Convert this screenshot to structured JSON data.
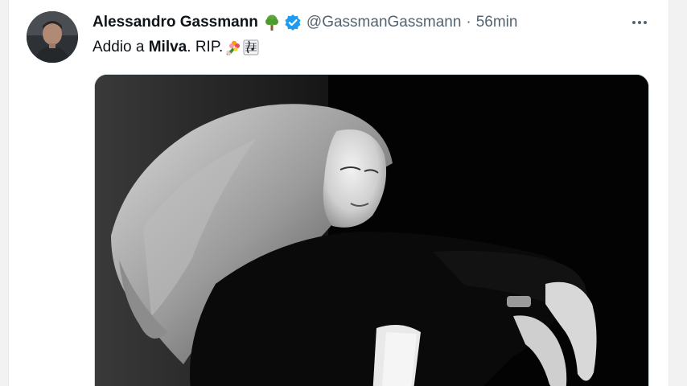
{
  "tweet": {
    "author_name": "Alessandro Gassmann",
    "handle": "@GassmanGassmann",
    "separator": "·",
    "time": "56min",
    "text_before": "Addio a ",
    "text_bold": "Milva",
    "text_after": ". RIP.",
    "icons": {
      "tree": "tree-emoji-icon",
      "verified": "verified-badge-icon",
      "more": "more-options-icon",
      "bouquet": "bouquet-emoji-icon",
      "music": "musical-score-emoji-icon"
    },
    "colors": {
      "verified": "#1d9bf0",
      "name": "#0f1419",
      "secondary": "#536471"
    }
  }
}
